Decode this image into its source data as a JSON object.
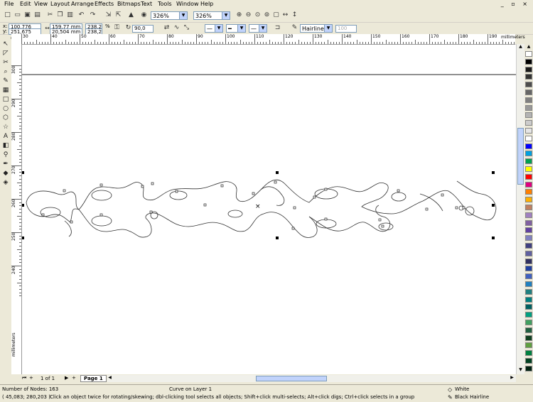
{
  "menu": [
    "File",
    "Edit",
    "View",
    "Layout",
    "Arrange",
    "Effects",
    "Bitmaps",
    "Text",
    "Tools",
    "Window",
    "Help"
  ],
  "window_controls": "_ ▫ ×",
  "toolbar1": {
    "zoom1": "326%",
    "zoom2": "326%"
  },
  "toolbar2": {
    "x": "100,776 mm",
    "y": "251,675 mm",
    "w": "159,77 mm",
    "h": "20,504 mm",
    "sx": "238,2",
    "sy": "238,2",
    "pct": "%",
    "angle": "90,0",
    "outline": "Hairline",
    "outline_num": "100"
  },
  "hruler": {
    "unit": "millimeters",
    "labels": [
      "30",
      "40",
      "50",
      "60",
      "70",
      "80",
      "90",
      "100",
      "110",
      "120",
      "130",
      "140",
      "150",
      "160",
      "170",
      "180",
      "190"
    ]
  },
  "vruler": {
    "unit": "millimeters",
    "labels": [
      "300",
      "290",
      "280",
      "270",
      "260",
      "250",
      "240"
    ]
  },
  "pagebar": {
    "count": "1 of 1",
    "tab": "Page 1"
  },
  "status": {
    "nodes": "Number of Nodes: 163",
    "object": "Curve on Layer 1",
    "coords": "( 45,083; 280,203 )",
    "hint": "Click an object twice for rotating/skewing; dbl-clicking tool selects all objects; Shift+click multi-selects; Alt+click digs; Ctrl+click selects in a group",
    "fill": "White",
    "stroke": "Black  Hairline"
  },
  "palette": [
    "#ffffff",
    "#000000",
    "#1a1a1a",
    "#333333",
    "#4d4d4d",
    "#666666",
    "#808080",
    "#999999",
    "#b3b3b3",
    "#cccccc",
    "#e6e6e6",
    "#ffffff",
    "#0000ff",
    "#00a0e0",
    "#00a050",
    "#ffff00",
    "#ff0000",
    "#e00080",
    "#ff8000",
    "#ffb000",
    "#c08060",
    "#a080c0",
    "#8060a0",
    "#6040a0",
    "#8080c0",
    "#404080",
    "#6060a0",
    "#303060",
    "#2040a0",
    "#4060c0",
    "#2080c0",
    "#208080",
    "#008080",
    "#006060",
    "#00a080",
    "#40a060",
    "#206040",
    "#104020",
    "#60a040",
    "#008040",
    "#004020",
    "#002010"
  ]
}
